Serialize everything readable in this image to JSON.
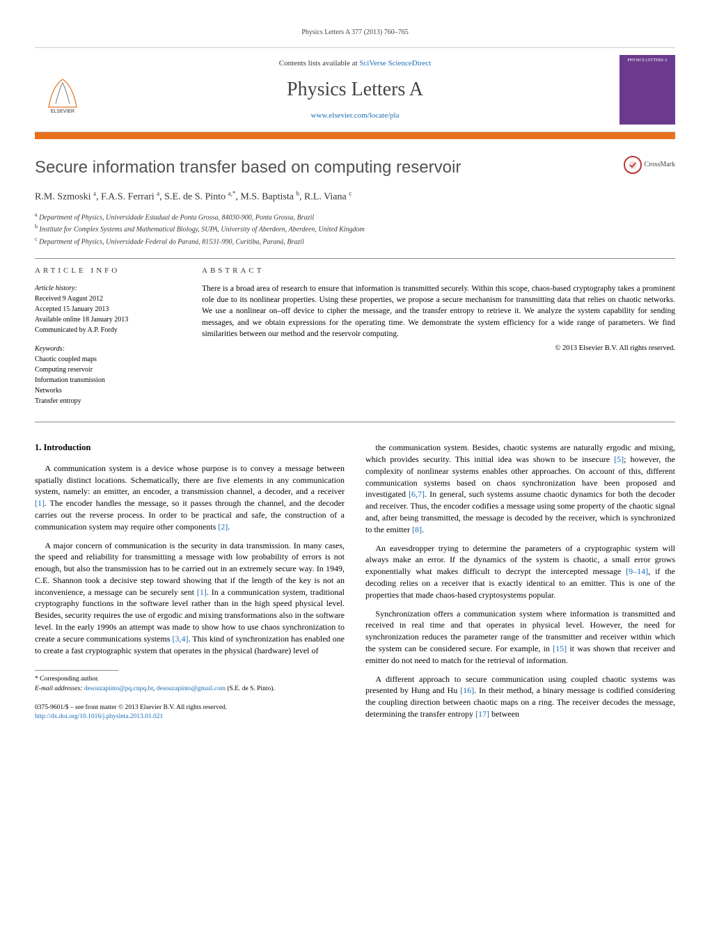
{
  "header_citation": "Physics Letters A 377 (2013) 760–765",
  "masthead": {
    "contents_prefix": "Contents lists available at ",
    "contents_link": "SciVerse ScienceDirect",
    "journal_name": "Physics Letters A",
    "homepage": "www.elsevier.com/locate/pla",
    "publisher": "ELSEVIER",
    "cover_label": "PHYSICS LETTERS A"
  },
  "title": "Secure information transfer based on computing reservoir",
  "crossmark_label": "CrossMark",
  "authors_html": "R.M. Szmoski <sup>a</sup>, F.A.S. Ferrari <sup>a</sup>, S.E. de S. Pinto <sup>a,*</sup>, M.S. Baptista <sup>b</sup>, R.L. Viana <sup>c</sup>",
  "affiliations": [
    {
      "sup": "a",
      "text": "Department of Physics, Universidade Estadual de Ponta Grossa, 84030-900, Ponta Grossa, Brazil"
    },
    {
      "sup": "b",
      "text": "Institute for Complex Systems and Mathematical Biology, SUPA, University of Aberdeen, Aberdeen, United Kingdom"
    },
    {
      "sup": "c",
      "text": "Department of Physics, Universidade Federal do Paraná, 81531-990, Curitiba, Paraná, Brazil"
    }
  ],
  "article_info": {
    "label": "ARTICLE INFO",
    "history_label": "Article history:",
    "history": [
      "Received 9 August 2012",
      "Accepted 15 January 2013",
      "Available online 18 January 2013",
      "Communicated by A.P. Fordy"
    ],
    "keywords_label": "Keywords:",
    "keywords": [
      "Chaotic coupled maps",
      "Computing reservoir",
      "Information transmission",
      "Networks",
      "Transfer entropy"
    ]
  },
  "abstract": {
    "label": "ABSTRACT",
    "text": "There is a broad area of research to ensure that information is transmitted securely. Within this scope, chaos-based cryptography takes a prominent role due to its nonlinear properties. Using these properties, we propose a secure mechanism for transmitting data that relies on chaotic networks. We use a nonlinear on–off device to cipher the message, and the transfer entropy to retrieve it. We analyze the system capability for sending messages, and we obtain expressions for the operating time. We demonstrate the system efficiency for a wide range of parameters. We find similarities between our method and the reservoir computing.",
    "copyright": "© 2013 Elsevier B.V. All rights reserved."
  },
  "body": {
    "section_number": "1.",
    "section_title": "Introduction",
    "left_paragraphs": [
      "A communication system is a device whose purpose is to convey a message between spatially distinct locations. Schematically, there are five elements in any communication system, namely: an emitter, an encoder, a transmission channel, a decoder, and a receiver [1]. The encoder handles the message, so it passes through the channel, and the decoder carries out the reverse process. In order to be practical and safe, the construction of a communication system may require other components [2].",
      "A major concern of communication is the security in data transmission. In many cases, the speed and reliability for transmitting a message with low probability of errors is not enough, but also the transmission has to be carried out in an extremely secure way. In 1949, C.E. Shannon took a decisive step toward showing that if the length of the key is not an inconvenience, a message can be securely sent [1]. In a communication system, traditional cryptography functions in the software level rather than in the high speed physical level. Besides, security requires the use of ergodic and mixing transformations also in the software level. In the early 1990s an attempt was made to show how to use chaos synchronization to create a secure communications systems [3,4]. This kind of synchronization has enabled one to create a fast cryptographic system that operates in the physical (hardware) level of"
    ],
    "right_paragraphs": [
      "the communication system. Besides, chaotic systems are naturally ergodic and mixing, which provides security. This initial idea was shown to be insecure [5]; however, the complexity of nonlinear systems enables other approaches. On account of this, different communication systems based on chaos synchronization have been proposed and investigated [6,7]. In general, such systems assume chaotic dynamics for both the decoder and receiver. Thus, the encoder codifies a message using some property of the chaotic signal and, after being transmitted, the message is decoded by the receiver, which is synchronized to the emitter [8].",
      "An eavesdropper trying to determine the parameters of a cryptographic system will always make an error. If the dynamics of the system is chaotic, a small error grows exponentially what makes difficult to decrypt the intercepted message [9–14], if the decoding relies on a receiver that is exactly identical to an emitter. This is one of the properties that made chaos-based cryptosystems popular.",
      "Synchronization offers a communication system where information is transmitted and received in real time and that operates in physical level. However, the need for synchronization reduces the parameter range of the transmitter and receiver within which the system can be considered secure. For example, in [15] it was shown that receiver and emitter do not need to match for the retrieval of information.",
      "A different approach to secure communication using coupled chaotic systems was presented by Hung and Hu [16]. In their method, a binary message is codified considering the coupling direction between chaotic maps on a ring. The receiver decodes the message, determining the transfer entropy [17] between"
    ]
  },
  "footnotes": {
    "corresponding": "* Corresponding author.",
    "email_label": "E-mail addresses:",
    "emails": [
      "desouzapinto@pq.cnpq.br",
      "desouzapinto@gmail.com"
    ],
    "email_person": "(S.E. de S. Pinto)."
  },
  "footer": {
    "issn_line": "0375-9601/$ – see front matter © 2013 Elsevier B.V. All rights reserved.",
    "doi": "http://dx.doi.org/10.1016/j.physleta.2013.01.021"
  }
}
